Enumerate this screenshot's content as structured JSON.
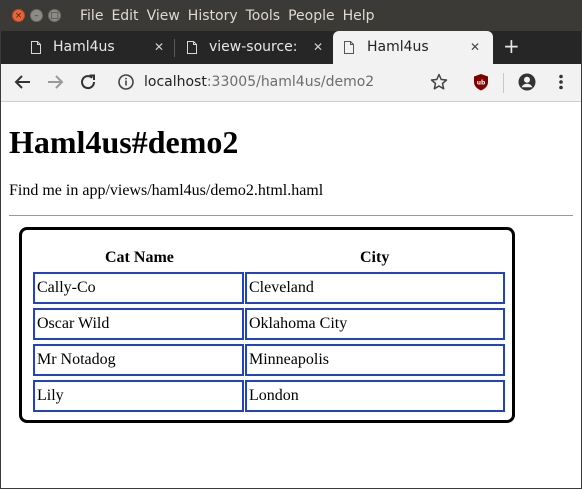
{
  "menu": [
    "File",
    "Edit",
    "View",
    "History",
    "Tools",
    "People",
    "Help"
  ],
  "tabs": [
    {
      "label": "Haml4us"
    },
    {
      "label": "view-source:lo"
    },
    {
      "label": "Haml4us"
    }
  ],
  "toolbar": {
    "url_host": "localhost",
    "url_rest": ":33005/haml4us/demo2"
  },
  "page": {
    "heading": "Haml4us#demo2",
    "note": "Find me in app/views/haml4us/demo2.html.haml",
    "table": {
      "headers": [
        "Cat Name",
        "City"
      ],
      "rows": [
        [
          "Cally-Co",
          "Cleveland"
        ],
        [
          "Oscar Wild",
          "Oklahoma City"
        ],
        [
          "Mr Notadog",
          "Minneapolis"
        ],
        [
          "Lily",
          "London"
        ]
      ]
    }
  }
}
